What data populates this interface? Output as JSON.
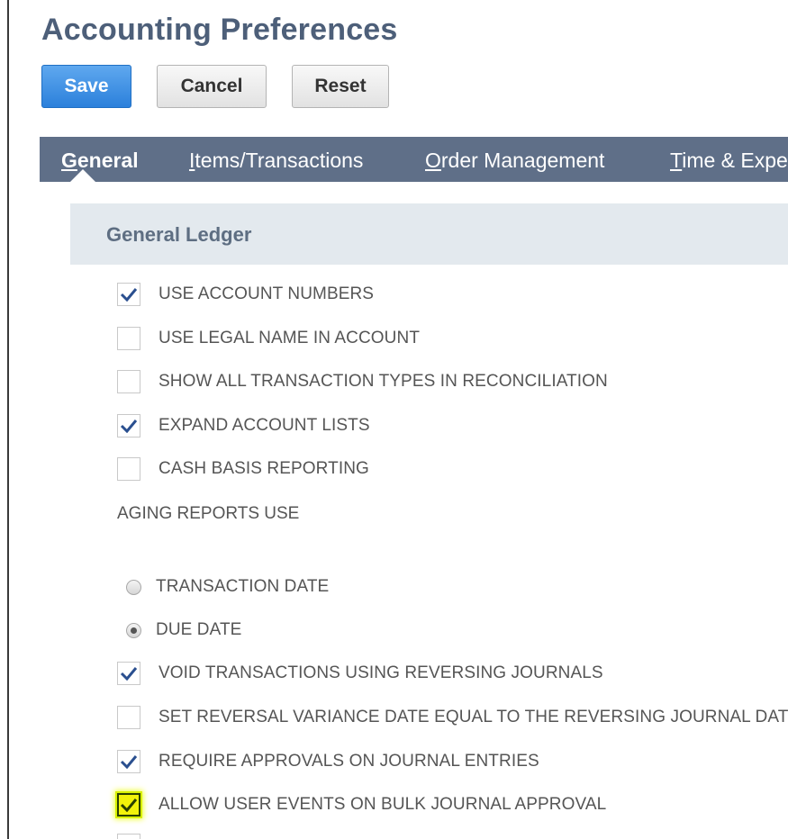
{
  "page": {
    "title": "Accounting Preferences"
  },
  "toolbar": {
    "save_label": "Save",
    "cancel_label": "Cancel",
    "reset_label": "Reset"
  },
  "tabs": [
    {
      "underline": "G",
      "rest": "eneral",
      "active": true
    },
    {
      "underline": "I",
      "rest": "tems/Transactions",
      "active": false
    },
    {
      "underline": "O",
      "rest": "rder Management",
      "active": false
    },
    {
      "underline": "T",
      "rest": "ime & Expenses",
      "active": false
    }
  ],
  "section": {
    "title": "General Ledger"
  },
  "options": {
    "use_account_numbers": {
      "label": "USE ACCOUNT NUMBERS",
      "checked": true
    },
    "use_legal_name": {
      "label": "USE LEGAL NAME IN ACCOUNT",
      "checked": false
    },
    "show_all_transaction_types": {
      "label": "SHOW ALL TRANSACTION TYPES IN RECONCILIATION",
      "checked": false
    },
    "expand_account_lists": {
      "label": "EXPAND ACCOUNT LISTS",
      "checked": true
    },
    "cash_basis_reporting": {
      "label": "CASH BASIS REPORTING",
      "checked": false
    },
    "aging_reports_use": {
      "label": "AGING REPORTS USE"
    },
    "aging_transaction_date": {
      "label": "TRANSACTION DATE",
      "selected": false
    },
    "aging_due_date": {
      "label": "DUE DATE",
      "selected": true
    },
    "void_using_reversing": {
      "label": "VOID TRANSACTIONS USING REVERSING JOURNALS",
      "checked": true
    },
    "set_reversal_variance_date": {
      "label": "SET REVERSAL VARIANCE DATE EQUAL TO THE REVERSING JOURNAL DATE",
      "checked": false
    },
    "require_approvals_journal": {
      "label": "REQUIRE APPROVALS ON JOURNAL ENTRIES",
      "checked": true
    },
    "allow_user_events_bulk": {
      "label": "ALLOW USER EVENTS ON BULK JOURNAL APPROVAL",
      "checked": true,
      "highlighted": true
    }
  },
  "colors": {
    "accent": "#2b80db",
    "tabbar": "#5f6f88",
    "title": "#4d5f79",
    "highlight": "#f2f20a"
  },
  "icons": {
    "check": "checkmark-icon"
  }
}
